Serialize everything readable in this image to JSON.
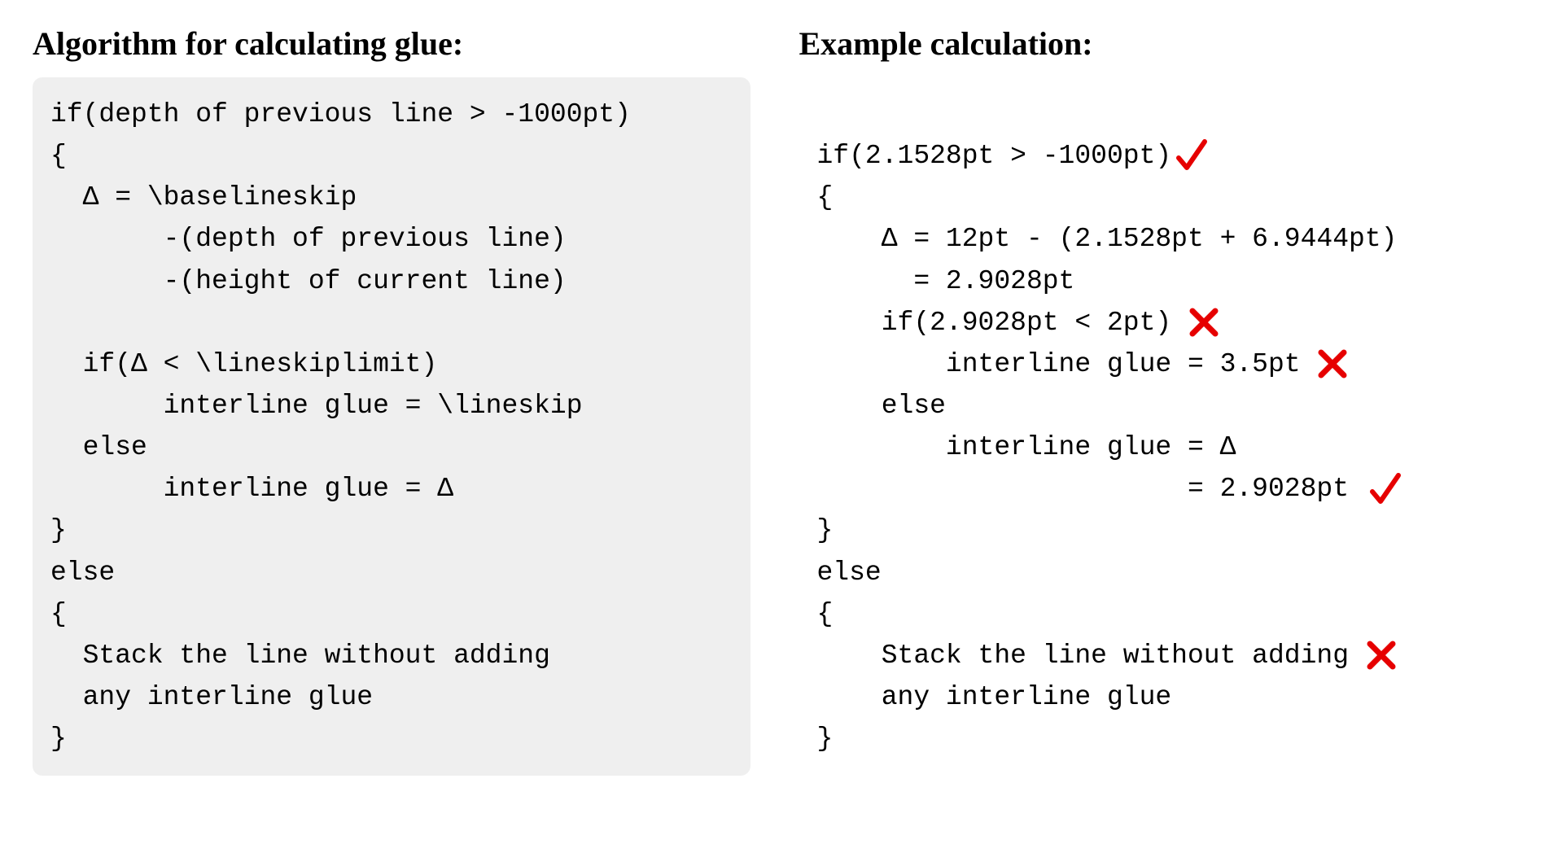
{
  "left": {
    "heading": "Algorithm for calculating glue:",
    "code": "if(depth of previous line > -1000pt)\n{\n  Δ = \\baselineskip\n       -(depth of previous line)\n       -(height of current line)\n\n  if(Δ < \\lineskiplimit)\n       interline glue = \\lineskip\n  else\n       interline glue = Δ\n}\nelse\n{\n  Stack the line without adding\n  any interline glue\n}"
  },
  "right": {
    "heading": "Example calculation:",
    "marks": {
      "line0": "check",
      "line4": "cross",
      "line5": "cross",
      "line8": "check",
      "line11": "cross"
    },
    "lines": {
      "l0": "if(2.1528pt > -1000pt)",
      "l1": "{",
      "l2": "    Δ = 12pt - (2.1528pt + 6.9444pt)",
      "l3": "      = 2.9028pt",
      "l4": "    if(2.9028pt < 2pt) ",
      "l5": "        interline glue = 3.5pt ",
      "l6": "    else",
      "l7": "        interline glue = Δ",
      "l8": "                       = 2.9028pt ",
      "l9": "}",
      "l10": "else",
      "l11": "{",
      "l12": "    Stack the line without adding ",
      "l13": "    any interline glue",
      "l14": "}"
    }
  }
}
